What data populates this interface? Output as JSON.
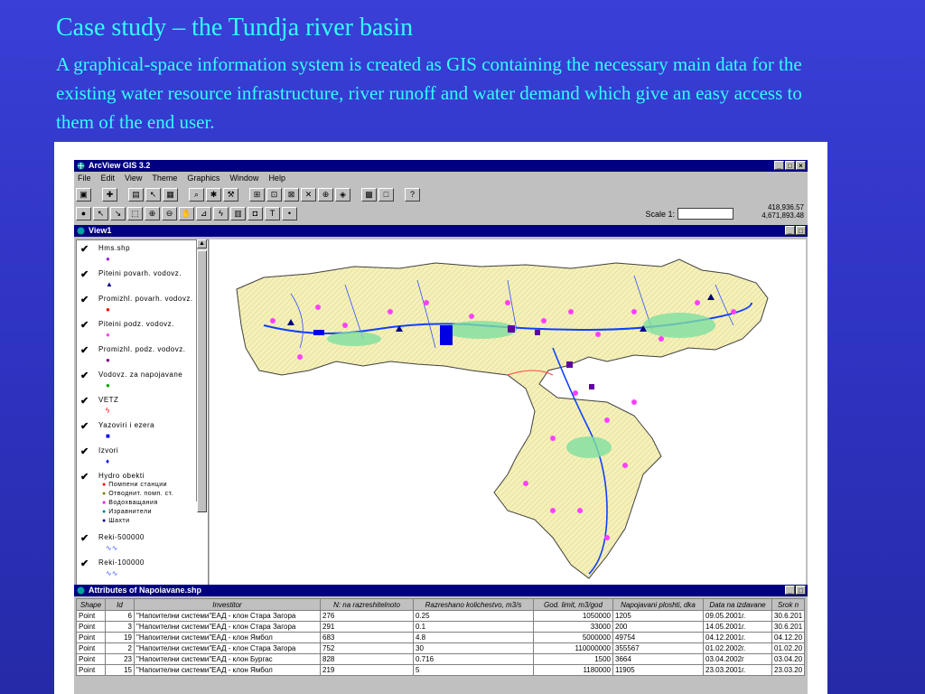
{
  "slide": {
    "title": "Case study – the Tundja river basin",
    "body": "A graphical-space information system is created as GIS containing the necessary main data for the existing water resource infrastructure, river runoff and water demand which give an easy access to them of the end user."
  },
  "app": {
    "title": "ArcView GIS 3.2",
    "menu": [
      "File",
      "Edit",
      "View",
      "Theme",
      "Graphics",
      "Window",
      "Help"
    ],
    "scale_label": "Scale 1:",
    "coord_x": "418,936.57",
    "coord_y": "4,671,893.48"
  },
  "view": {
    "title": "View1",
    "legend": [
      {
        "label": "Hms.shp",
        "sym": "●",
        "color": "#a020f0"
      },
      {
        "label": "Piteini povarh. vodovz.",
        "sym": "▲",
        "color": "#000080"
      },
      {
        "label": "Promizhl. povarh. vodovz.",
        "sym": "●",
        "color": "#ff0000"
      },
      {
        "label": "Piteini podz. vodovz.",
        "sym": "●",
        "color": "#ff40ff"
      },
      {
        "label": "Promizhl. podz. vodovz.",
        "sym": "●",
        "color": "#800080"
      },
      {
        "label": "Vodovz. za napojavane",
        "sym": "●",
        "color": "#00a000"
      },
      {
        "label": "VETZ",
        "sym": "ϟ",
        "color": "#ff0000"
      },
      {
        "label": "Yazoviri i ezera",
        "sym": "■",
        "color": "#0000ff"
      },
      {
        "label": "Izvori",
        "sym": "♦",
        "color": "#0000ff"
      }
    ],
    "hydro_label": "Hydro obekti",
    "hydro_sub": [
      "Помпени станции",
      "Отводнит. помп. ст.",
      "Водохващания",
      "Изравнители",
      "Шахти"
    ],
    "hydro_colors": [
      "#ff0000",
      "#808000",
      "#ff00ff",
      "#008080",
      "#000080"
    ],
    "reki": [
      "Reki-500000",
      "Reki-100000"
    ]
  },
  "attributes": {
    "title": "Attributes of Napoiavane.shp",
    "columns": [
      "Shape",
      "Id",
      "Investitor",
      "N: na razreshitelnoto",
      "Razreshano kolichestvo, m3/s",
      "God. limit, m3/god",
      "Napojavani ploshti, dka",
      "Data na izdavane",
      "Srok n"
    ],
    "rows": [
      [
        "Point",
        "6",
        "\"Напоителни системи\"ЕАД - клон Стара Загора",
        "276",
        "0.25",
        "1050000",
        "1205",
        "09.05.2001г.",
        "30.6.201"
      ],
      [
        "Point",
        "3",
        "\"Напоителни системи\"ЕАД - клон Стара Загора",
        "291",
        "0.1",
        "33000",
        "200",
        "14.05.2001г.",
        "30.6.201"
      ],
      [
        "Point",
        "19",
        "\"Напоителни системи\"ЕАД - клон Ямбол",
        "683",
        "4.8",
        "5000000",
        "49754",
        "04.12.2001г.",
        "04.12.20"
      ],
      [
        "Point",
        "2",
        "\"Напоителни системи\"ЕАД - клон Стара Загора",
        "752",
        "30",
        "110000000",
        "355567",
        "01.02.2002г.",
        "01.02.20"
      ],
      [
        "Point",
        "23",
        "\"Напоителни системи\"ЕАД - клон Бургас",
        "828",
        "0.716",
        "1500",
        "3664",
        "03.04.2002г",
        "03.04.20"
      ],
      [
        "Point",
        "15",
        "\"Напоителни системи\"ЕАД - клон Ямбол",
        "219",
        "5",
        "1180000",
        "11905",
        "23.03.2001г.",
        "23.03.20"
      ]
    ]
  }
}
